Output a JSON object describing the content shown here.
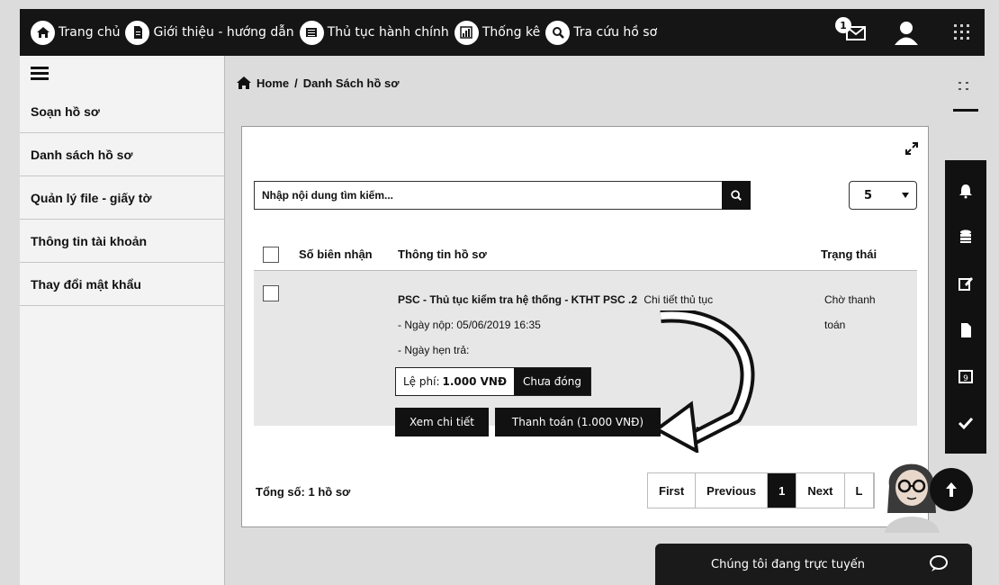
{
  "topnav": {
    "items": [
      {
        "label": "Trang chủ",
        "icon": "home-icon"
      },
      {
        "label": "Giới thiệu - hướng dẫn",
        "icon": "document-icon"
      },
      {
        "label": "Thủ tục hành chính",
        "icon": "list-icon"
      },
      {
        "label": "Thống kê",
        "icon": "chart-icon"
      },
      {
        "label": "Tra cứu hồ sơ",
        "icon": "search-icon"
      }
    ],
    "notification_count": "1"
  },
  "sidebar": {
    "items": [
      {
        "label": "Soạn hồ sơ"
      },
      {
        "label": "Danh sách hồ sơ"
      },
      {
        "label": "Quản lý file - giấy tờ"
      },
      {
        "label": "Thông tin tài khoản"
      },
      {
        "label": "Thay đổi mật khẩu"
      }
    ]
  },
  "breadcrumb": {
    "home": "Home",
    "separator": "/",
    "current": "Danh Sách hồ sơ"
  },
  "search": {
    "placeholder": "Nhập nội dung tìm kiếm...",
    "page_size": "5"
  },
  "table": {
    "headers": {
      "code": "Số biên nhận",
      "info": "Thông tin hồ sơ",
      "status": "Trạng thái"
    },
    "row": {
      "title": "PSC - Thủ tục kiểm tra hệ thống - KTHT PSC .2",
      "detail_link": "Chi tiết thủ tục",
      "submit_date": "- Ngày nộp: 05/06/2019 16:35",
      "return_date": "- Ngày hẹn trả:",
      "status": "Chờ thanh toán",
      "fee_label": "Lệ phí:",
      "fee_amount": "1.000 VNĐ",
      "fee_status": "Chưa đóng",
      "view_button": "Xem chi tiết",
      "pay_button": "Thanh toán (1.000 VNĐ)"
    }
  },
  "footer": {
    "total": "Tổng số: 1 hồ sơ"
  },
  "pager": {
    "first": "First",
    "previous": "Previous",
    "current": "1",
    "next": "Next",
    "last": "L"
  },
  "chat": {
    "label": "Chúng tôi đang trực tuyến"
  },
  "colors": {
    "dark": "#111111",
    "row_bg": "#e7e7e7",
    "sidebar_bg": "#f3f3f3"
  }
}
